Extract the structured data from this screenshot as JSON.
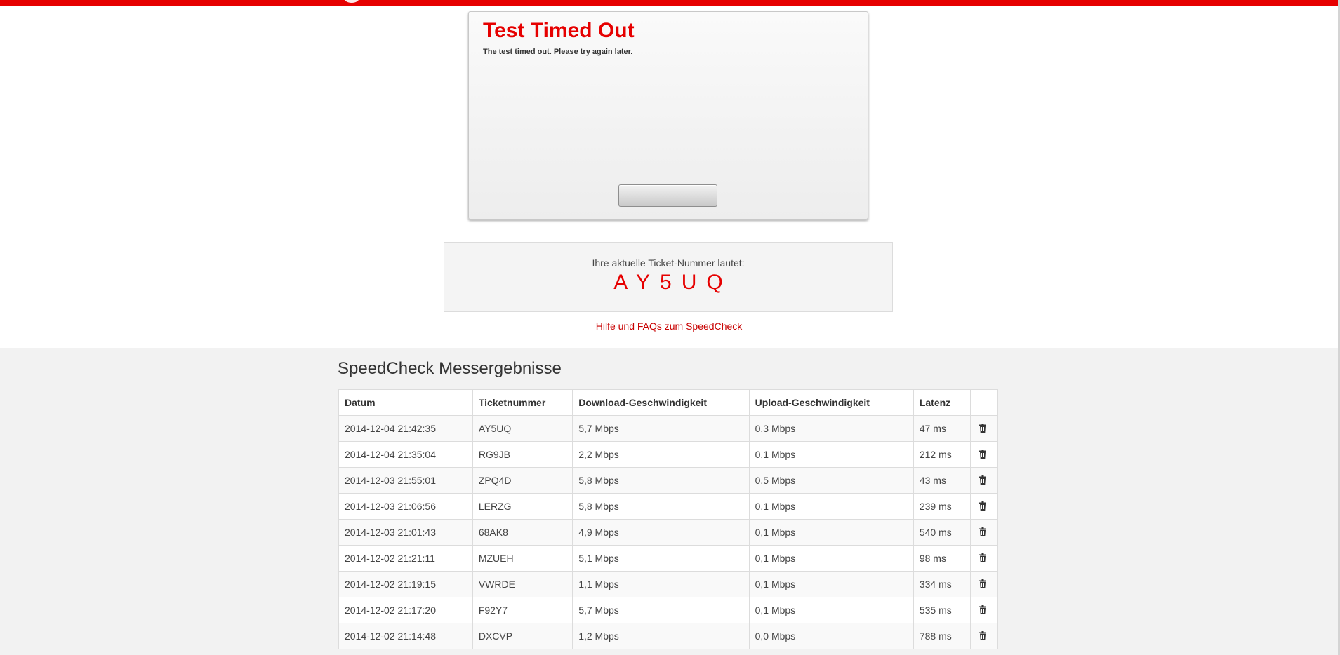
{
  "dialog": {
    "title": "Test Timed Out",
    "message": "The test timed out. Please try again later.",
    "button_label": ""
  },
  "ticket": {
    "label": "Ihre aktuelle Ticket-Nummer lautet:",
    "code": "AY5UQ"
  },
  "help_link": "Hilfe und FAQs zum SpeedCheck",
  "results": {
    "title": "SpeedCheck Messergebnisse",
    "columns": [
      "Datum",
      "Ticketnummer",
      "Download-Geschwindigkeit",
      "Upload-Geschwindigkeit",
      "Latenz",
      ""
    ],
    "rows": [
      {
        "datum": "2014-12-04 21:42:35",
        "ticket": "AY5UQ",
        "download": "5,7 Mbps",
        "upload": "0,3 Mbps",
        "latenz": "47 ms"
      },
      {
        "datum": "2014-12-04 21:35:04",
        "ticket": "RG9JB",
        "download": "2,2 Mbps",
        "upload": "0,1 Mbps",
        "latenz": "212 ms"
      },
      {
        "datum": "2014-12-03 21:55:01",
        "ticket": "ZPQ4D",
        "download": "5,8 Mbps",
        "upload": "0,5 Mbps",
        "latenz": "43 ms"
      },
      {
        "datum": "2014-12-03 21:06:56",
        "ticket": "LERZG",
        "download": "5,8 Mbps",
        "upload": "0,1 Mbps",
        "latenz": "239 ms"
      },
      {
        "datum": "2014-12-03 21:01:43",
        "ticket": "68AK8",
        "download": "4,9 Mbps",
        "upload": "0,1 Mbps",
        "latenz": "540 ms"
      },
      {
        "datum": "2014-12-02 21:21:11",
        "ticket": "MZUEH",
        "download": "5,1 Mbps",
        "upload": "0,1 Mbps",
        "latenz": "98 ms"
      },
      {
        "datum": "2014-12-02 21:19:15",
        "ticket": "VWRDE",
        "download": "1,1 Mbps",
        "upload": "0,1 Mbps",
        "latenz": "334 ms"
      },
      {
        "datum": "2014-12-02 21:17:20",
        "ticket": "F92Y7",
        "download": "5,7 Mbps",
        "upload": "0,1 Mbps",
        "latenz": "535 ms"
      },
      {
        "datum": "2014-12-02 21:14:48",
        "ticket": "DXCVP",
        "download": "1,2 Mbps",
        "upload": "0,0 Mbps",
        "latenz": "788 ms"
      }
    ]
  },
  "colors": {
    "brand_red": "#e60000",
    "link_red": "#c80000"
  },
  "icons": {
    "delete": "trash-icon"
  }
}
